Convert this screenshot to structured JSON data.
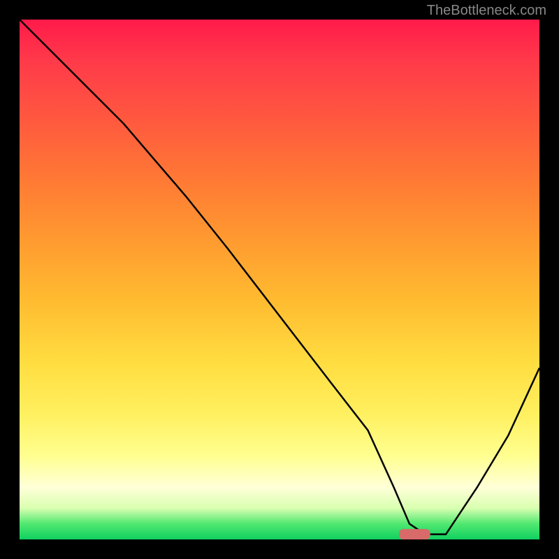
{
  "watermark": "TheBottleneck.com",
  "chart_data": {
    "type": "line",
    "title": "",
    "xlabel": "",
    "ylabel": "",
    "xlim": [
      0,
      100
    ],
    "ylim": [
      0,
      100
    ],
    "grid": false,
    "gradient_bg": true,
    "series": [
      {
        "name": "curve",
        "x": [
          0,
          10,
          20,
          26,
          32,
          40,
          50,
          60,
          67,
          72,
          75,
          78,
          82,
          88,
          94,
          100
        ],
        "values": [
          100,
          90,
          80,
          73,
          66,
          56,
          43,
          30,
          21,
          10,
          3,
          1,
          1,
          10,
          20,
          33
        ]
      }
    ],
    "marker": {
      "x": 76,
      "y": 1,
      "width": 6,
      "height": 2,
      "color": "#d86a6a"
    }
  }
}
